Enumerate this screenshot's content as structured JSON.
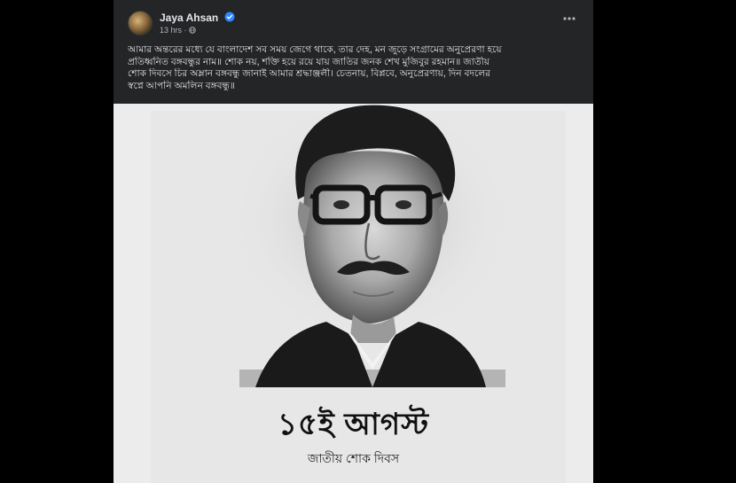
{
  "post": {
    "author": "Jaya Ahsan",
    "time": "13 hrs",
    "separator": "·",
    "text_lines": [
      "আমার অন্তরের মধ্যে যে বাংলাদেশ সব সময় জেগে থাকে, তার দেহ, মন জুড়ে সংগ্রামের অনুপ্রেরণা হয়ে",
      "প্রতিধ্বনিত বঙ্গবন্ধুর নাম॥ শোক নয়, শক্তি হয়ে রয়ে যায় জাতির জনক শেখ মুজিবুর রহমান॥ জাতীয়",
      "শোক দিবসে চির অম্লান বঙ্গবন্ধু জানাই আমার শ্রদ্ধাঞ্জলী। চেতনায়, বিপ্লবে, অনুপ্রেরণায়, দিন বদলের",
      "স্বপ্নে আপনি অমলিন বঙ্গবন্ধু॥"
    ]
  },
  "poster": {
    "title": "১৫ই আগস্ট",
    "subtitle": "জাতীয় শোক দিবস"
  },
  "icons": {
    "verified": "verified-badge-icon",
    "audience": "globe-icon",
    "more": "more-options-icon"
  },
  "colors": {
    "background": "#000000",
    "card": "#242526",
    "text_primary": "#e4e6eb",
    "text_secondary": "#b0b3b8",
    "verified_blue": "#2d88ff",
    "poster_bg": "#ececec"
  }
}
